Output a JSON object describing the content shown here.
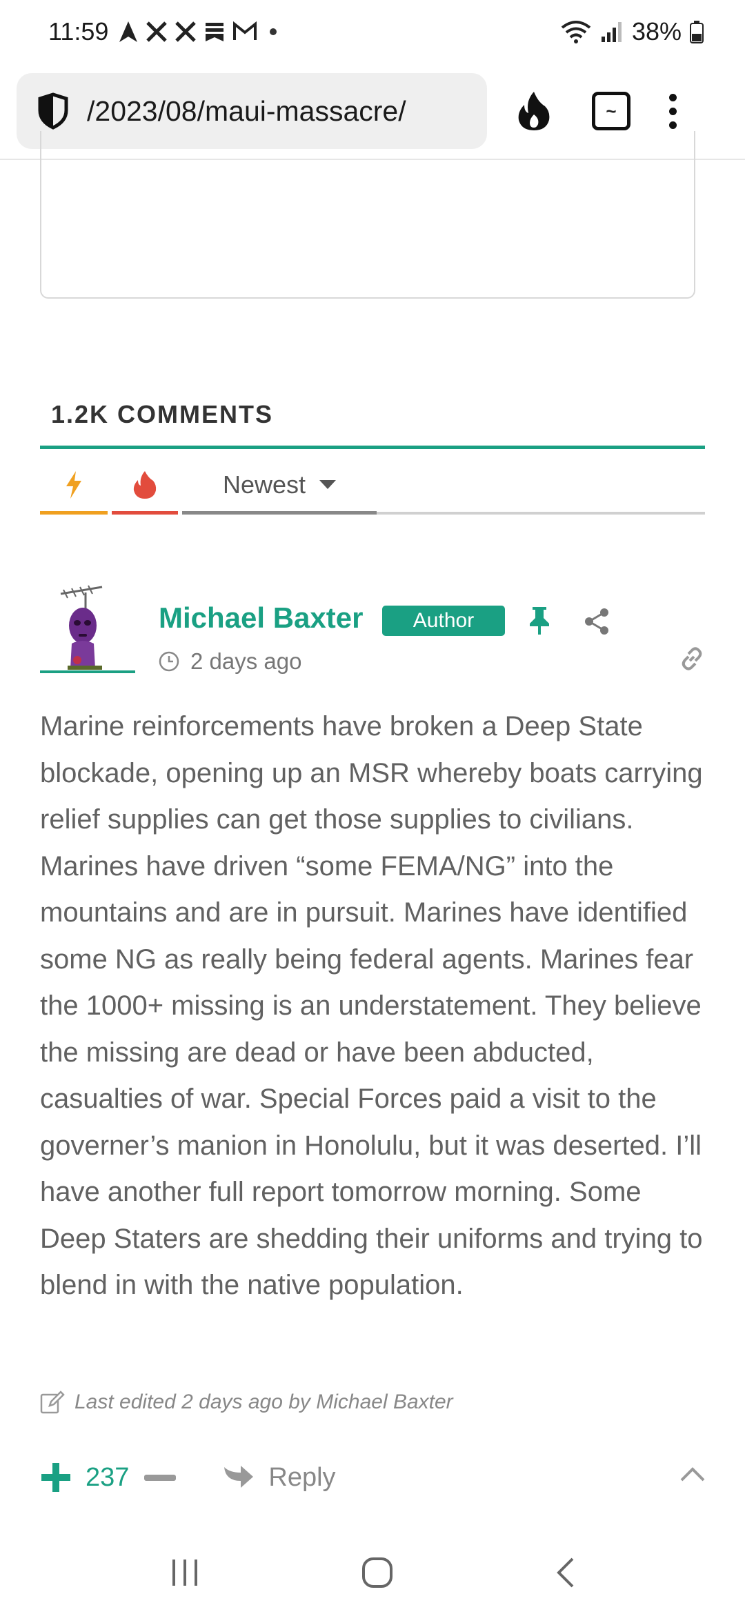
{
  "status_bar": {
    "time": "11:59",
    "battery": "38%"
  },
  "browser": {
    "url": "/2023/08/maui-massacre/",
    "tab_count": "~"
  },
  "comments": {
    "count_label": "1.2K COMMENTS",
    "sort": {
      "selected": "Newest"
    }
  },
  "comment": {
    "author": "Michael Baxter",
    "badge": "Author",
    "time": "2 days ago",
    "body": "Marine reinforcements have broken a Deep State blockade, opening up an MSR whereby boats carrying relief supplies can get those supplies to civilians. Marines have driven “some FEMA/NG” into the mountains and are in pursuit. Marines have identified some NG as really being federal agents. Marines fear the 1000+ missing is an understatement. They believe the missing are dead or have been abducted, casualties of war. Special Forces paid a visit to the governer’s manion in Honolulu, but it was deserted. I’ll have another full report tomorrow morning. Some Deep Staters are shedding their uniforms and trying to blend in with the native population.",
    "edited_note": "Last edited 2 days ago by Michael Baxter",
    "votes": "237",
    "reply_label": "Reply"
  },
  "colors": {
    "accent": "#1aa083",
    "hot_orange": "#f0a020",
    "hot_red": "#e24c3d",
    "body_text": "#616161"
  },
  "icons": {
    "security": "shield-icon",
    "hot": "flame-icon",
    "menu": "kebab-menu-icon",
    "sort_hot": "lightning-icon",
    "sort_popular": "flame-icon",
    "pin": "pin-icon",
    "share": "share-icon",
    "permalink": "link-icon",
    "edit": "edit-icon",
    "upvote": "plus-icon",
    "downvote": "minus-icon",
    "reply": "reply-arrow-icon",
    "collapse": "chevron-up-icon"
  }
}
